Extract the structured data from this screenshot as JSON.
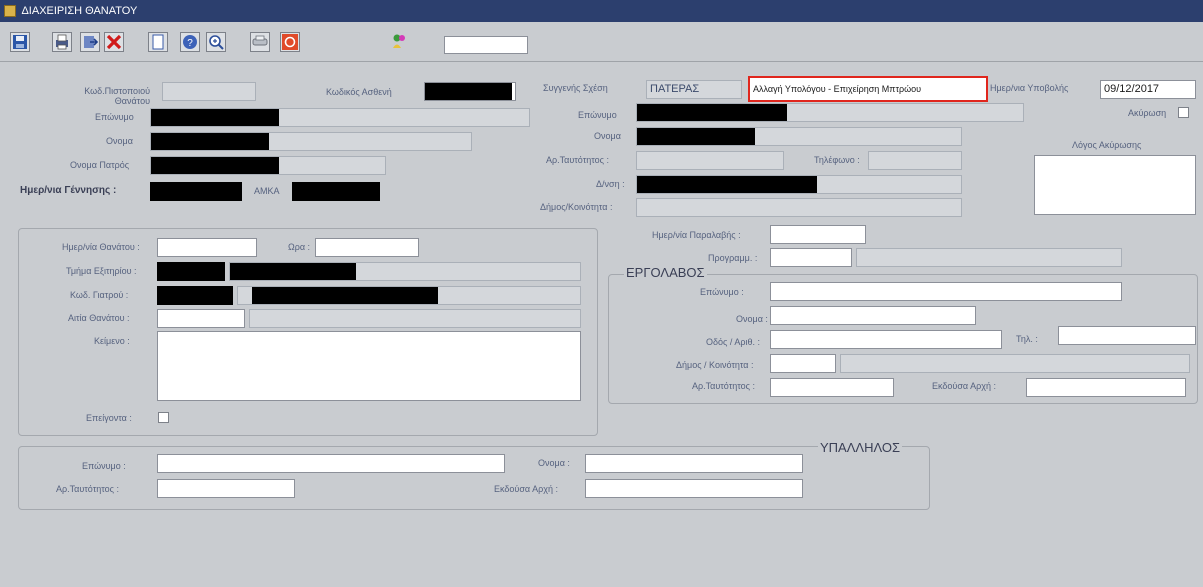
{
  "window": {
    "title": "ΔΙΑΧΕΙΡΙΣΗ ΘΑΝΑΤΟΥ"
  },
  "toolbar": {
    "buttons": [
      {
        "name": "save-icon"
      },
      {
        "name": "print-icon"
      },
      {
        "name": "export-icon"
      },
      {
        "name": "delete-icon"
      },
      {
        "name": "new-document-icon"
      },
      {
        "name": "help-icon"
      },
      {
        "name": "zoom-icon"
      },
      {
        "name": "attach-icon"
      },
      {
        "name": "exit-icon"
      },
      {
        "name": "user-icon"
      }
    ],
    "search_value": ""
  },
  "colors": {
    "titlebar": "#2c3f6e",
    "highlight": "#e0261d",
    "background": "#c9ccd0"
  },
  "patient": {
    "hospital_code_label": "Κωδ.Πιστοποιού Θανάτου",
    "patient_code_label": "Κωδικός Ασθενή",
    "surname_label": "Επώνυμο",
    "name_label": "Ονομα",
    "father_name_label": "Ονομα Πατρός",
    "birth_date_label": "Ημερ/νια Γέννησης :",
    "amka_label": "ΑΜΚΑ"
  },
  "relative": {
    "relation_label": "Συγγενής Σχέση",
    "relation_value": "ΠΑΤΕΡΑΣ",
    "highlighted_text": "Αλλαγή Υπολόγου - Επιχείρηση Μπτρώου",
    "submit_date_label": "Ημερ/νια Υποβολής",
    "submit_date_value": "09/12/2017",
    "cancel_label": "Ακύρωση",
    "cancel_reason_label": "Λόγος Ακύρωσης",
    "surname_label": "Επώνυμο",
    "name_label": "Ονομα",
    "id_label": "Αρ.Ταυτότητος :",
    "phone_label": "Τηλέφωνο :",
    "address_label": "Δ/νση :",
    "municipality_label": "Δήμος/Κοινότητα :"
  },
  "death": {
    "date_label": "Ημερ/νία Θανάτου :",
    "time_label": "Ωρα :",
    "department_label": "Τμήμα Εξιτηρίου :",
    "doctor_code_label": "Κωδ. Γιατρού :",
    "cause_label": "Αιτία Θανάτου :",
    "text_label": "Κείμενο :",
    "urgent_label": "Επείγοντα :"
  },
  "receipt": {
    "date_label": "Ημερ/νία Παραλαβής :",
    "scheduled_label": "Προγραμμ. :"
  },
  "contractor": {
    "title": "ΕΡΓΟΛΑΒΟΣ",
    "surname_label": "Επώνυμο :",
    "name_label": "Ονομα :",
    "street_label": "Οδός / Αριθ. :",
    "phone_label": "Τηλ. :",
    "municipality_label": "Δήμος / Κοινότητα :",
    "id_label": "Αρ.Ταυτότητος :",
    "issuer_label": "Εκδούσα Αρχή :"
  },
  "employee": {
    "title": "ΥΠΑΛΛΗΛΟΣ",
    "surname_label": "Επώνυμο :",
    "name_label": "Ονομα :",
    "id_label": "Αρ.Ταυτότητος :",
    "issuer_label": "Εκδούσα Αρχή :"
  }
}
